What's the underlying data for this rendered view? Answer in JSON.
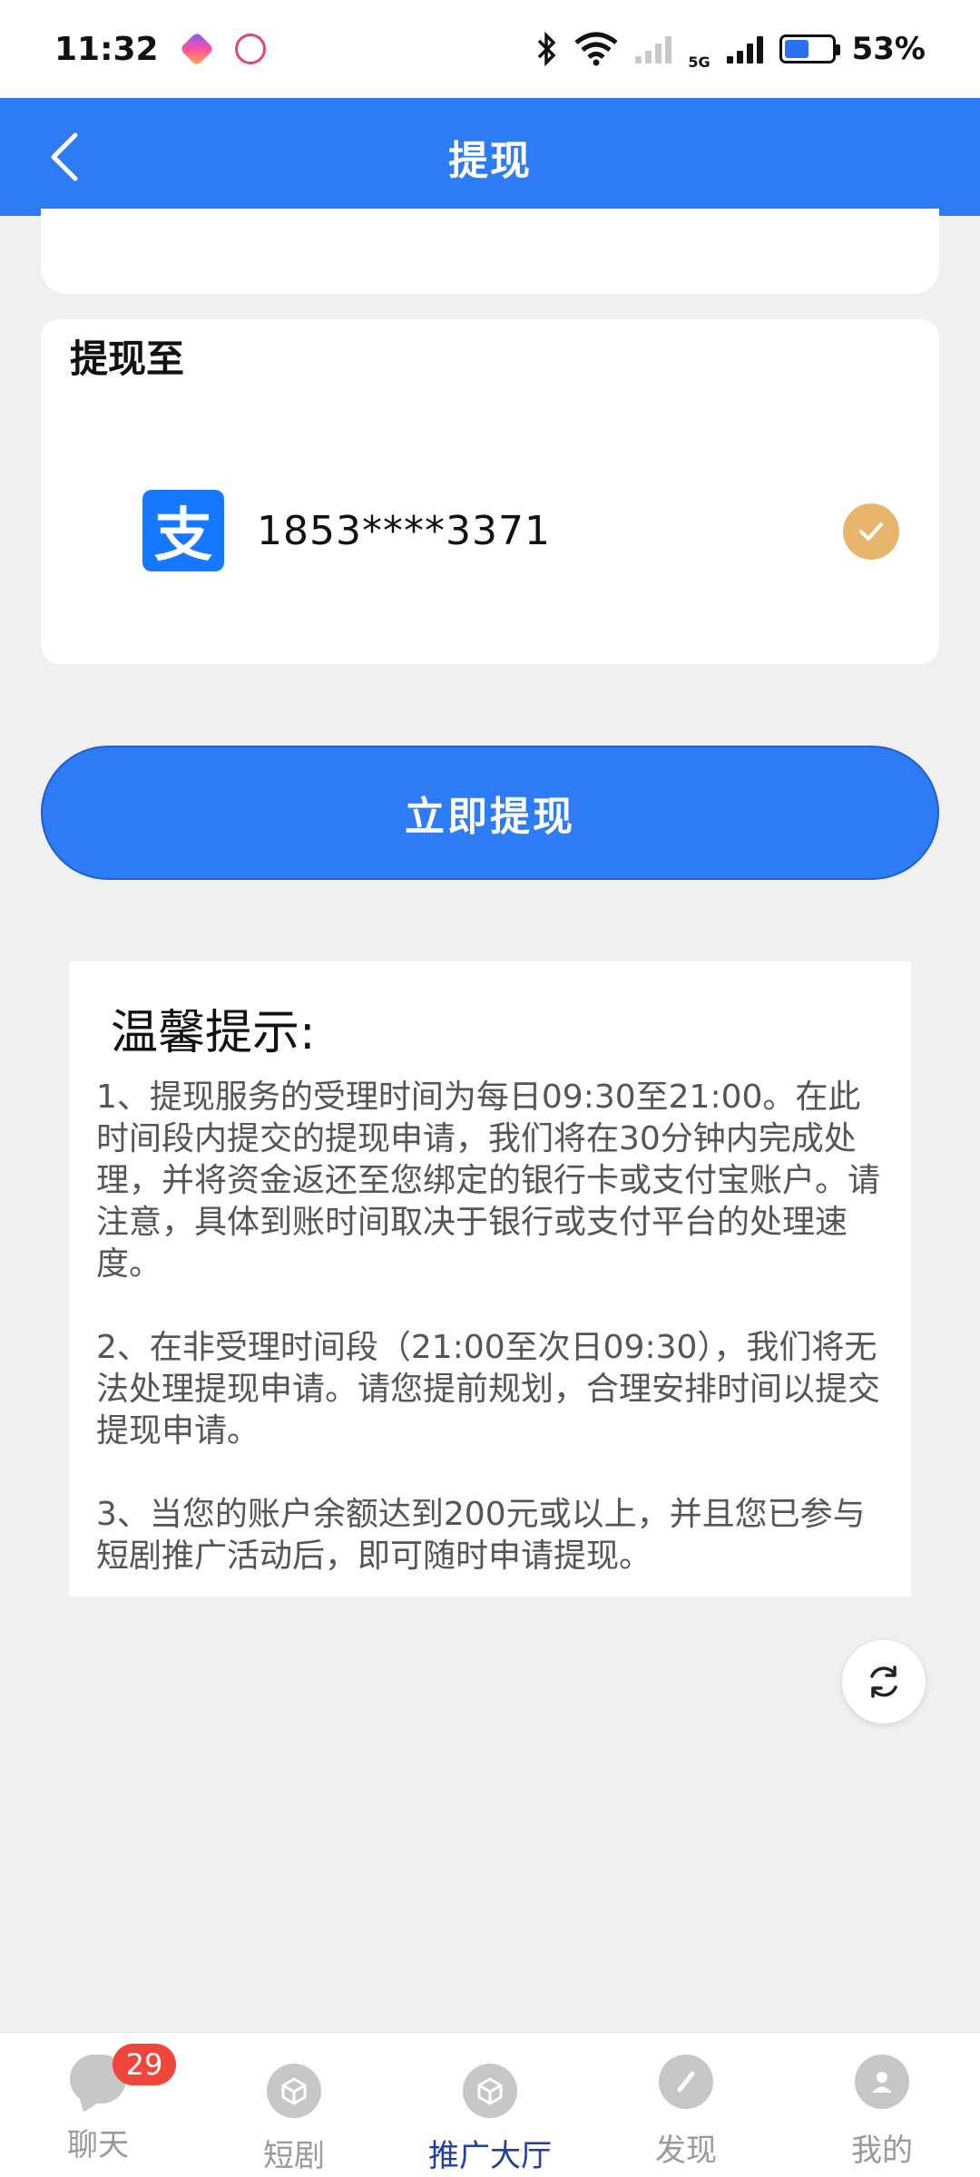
{
  "status_bar": {
    "time": "11:32",
    "network": "5G",
    "battery_percent": "53%",
    "battery_level": 0.53
  },
  "header": {
    "title": "提现"
  },
  "withdraw_to": {
    "section_title": "提现至",
    "account_icon": "alipay-icon",
    "account_number": "1853****3371",
    "selected": true
  },
  "submit_button": {
    "label": "立即提现"
  },
  "tips": {
    "title": "温馨提示:",
    "paragraphs": [
      "1、提现服务的受理时间为每日09:30至21:00。在此时间段内提交的提现申请，我们将在30分钟内完成处理，并将资金返还至您绑定的银行卡或支付宝账户。请注意，具体到账时间取决于银行或支付平台的处理速度。",
      "2、在非受理时间段（21:00至次日09:30），我们将无法处理提现申请。请您提前规划，合理安排时间以提交提现申请。",
      "3、当您的账户余额达到200元或以上，并且您已参与短剧推广活动后，即可随时申请提现。"
    ]
  },
  "bottom_nav": {
    "items": [
      {
        "label": "聊天",
        "icon": "chat-icon",
        "badge": "29"
      },
      {
        "label": "短剧",
        "icon": "box-icon"
      },
      {
        "label": "推广大厅",
        "icon": "box-icon",
        "active": true
      },
      {
        "label": "发现",
        "icon": "compass-icon"
      },
      {
        "label": "我的",
        "icon": "user-icon"
      }
    ]
  },
  "colors": {
    "primary": "#2e7bf6",
    "check": "#e8b56c",
    "badge": "#f0453a",
    "active_nav": "#1f3fa8"
  }
}
